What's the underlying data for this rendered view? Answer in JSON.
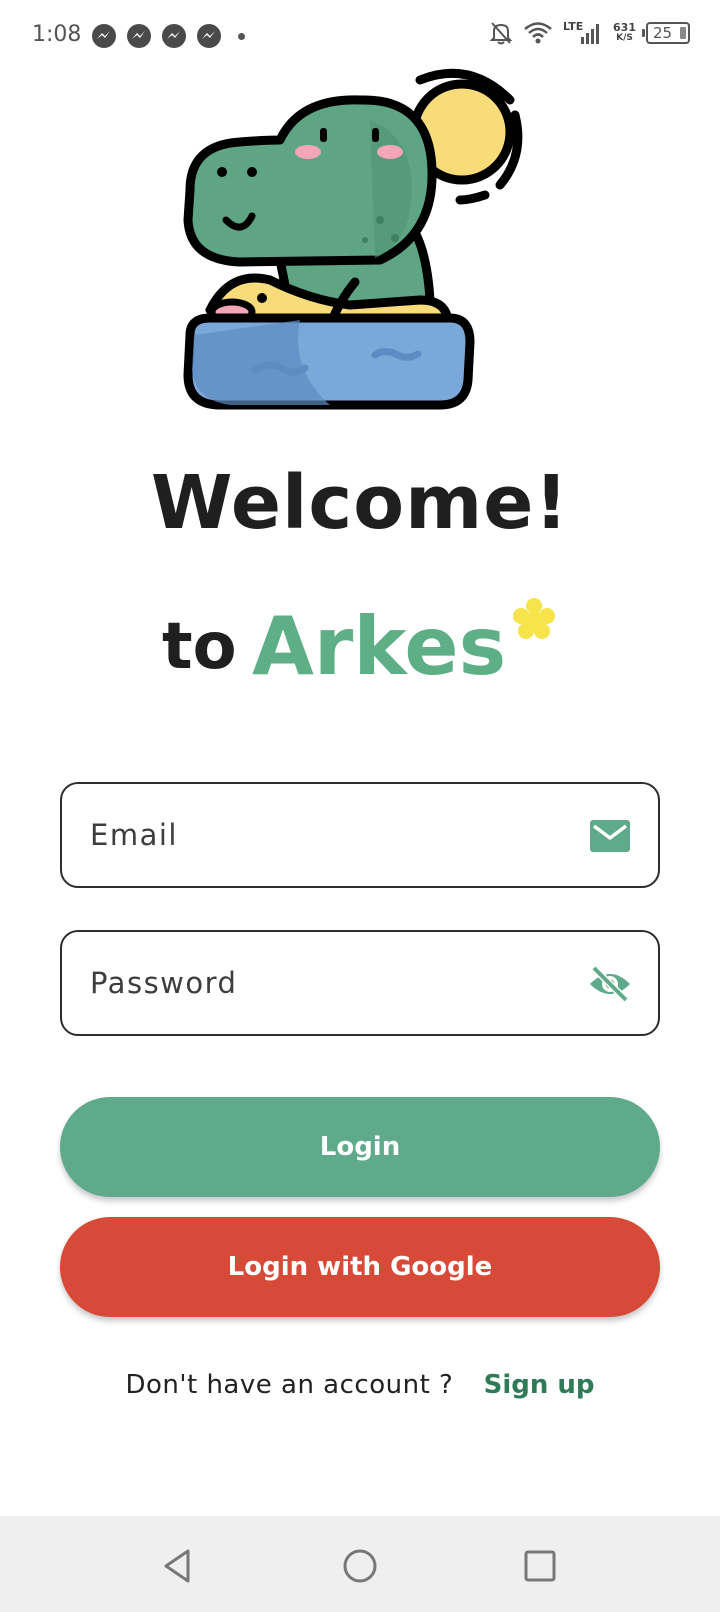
{
  "status_bar": {
    "time": "1:08",
    "network": "LTE",
    "speed_value": "631",
    "speed_unit": "K/S",
    "battery": "25",
    "icons": [
      "messenger-icon",
      "messenger-icon",
      "messenger-icon",
      "messenger-icon",
      "dot-icon",
      "muted-bell-icon",
      "wifi-icon",
      "signal-icon",
      "battery-icon"
    ]
  },
  "hero": {
    "illustration": "dinosaur-in-swim-ring-illustration",
    "welcome": "Welcome!",
    "to": "to",
    "app_name": "Arkes"
  },
  "form": {
    "email_placeholder": "Email",
    "email_icon": "envelope-icon",
    "password_placeholder": "Password",
    "password_icon": "eye-slash-icon"
  },
  "buttons": {
    "login": "Login",
    "google": "Login with Google"
  },
  "signup": {
    "prompt": "Don't have an account ?",
    "link": "Sign up"
  },
  "colors": {
    "brand_green": "#5eaf86",
    "login_button": "#5eaa8a",
    "google_button": "#d84a38",
    "signup_link": "#2f7a57"
  },
  "nav_bar": {
    "icons": [
      "back-icon",
      "home-icon",
      "recents-icon"
    ]
  }
}
